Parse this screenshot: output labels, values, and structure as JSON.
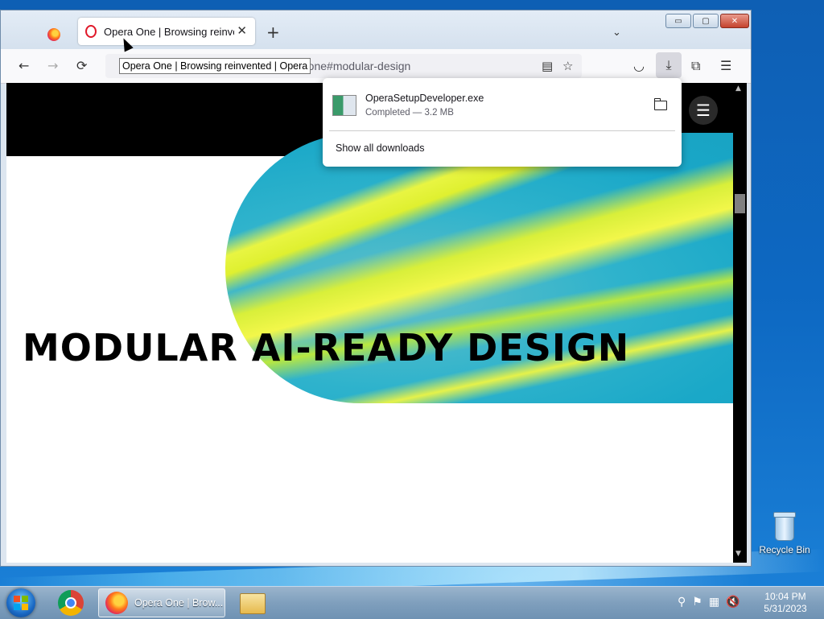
{
  "browser": {
    "tab": {
      "title": "Opera One | Browsing reinvented | Opera",
      "close": "✕"
    },
    "newtab": "+",
    "tablist": "⌄",
    "window_buttons": {
      "minimize": "▭",
      "maximize": "▢",
      "close": "✕"
    },
    "nav": {
      "back": "←",
      "forward": "→",
      "reload": "⟳"
    },
    "url_visible": "n/one#modular-design",
    "url_icons": {
      "reader": "▤",
      "bookmark": "☆"
    },
    "toolbar": {
      "pocket": "◡",
      "download": "⤓",
      "extensions": "⧉",
      "menu": "☰"
    },
    "tooltip": "Opera One | Browsing reinvented | Opera"
  },
  "downloads": {
    "file_name": "OperaSetupDeveloper.exe",
    "status": "Completed — 3.2 MB",
    "show_all": "Show all downloads"
  },
  "page": {
    "headline": "MODULAR AI-READY DESIGN",
    "menu_icon": "☰",
    "colors": {
      "accent_cyan": "#1aa8c8",
      "accent_yellow": "#e8f542",
      "header_bg": "#000000"
    }
  },
  "desktop": {
    "recycle_bin": "Recycle Bin"
  },
  "taskbar": {
    "firefox_label": "Opera One | Brow...",
    "tray": {
      "search": "⚲",
      "flag": "⚑",
      "network": "▦",
      "volume": "🔇"
    },
    "time": "10:04 PM",
    "date": "5/31/2023"
  }
}
